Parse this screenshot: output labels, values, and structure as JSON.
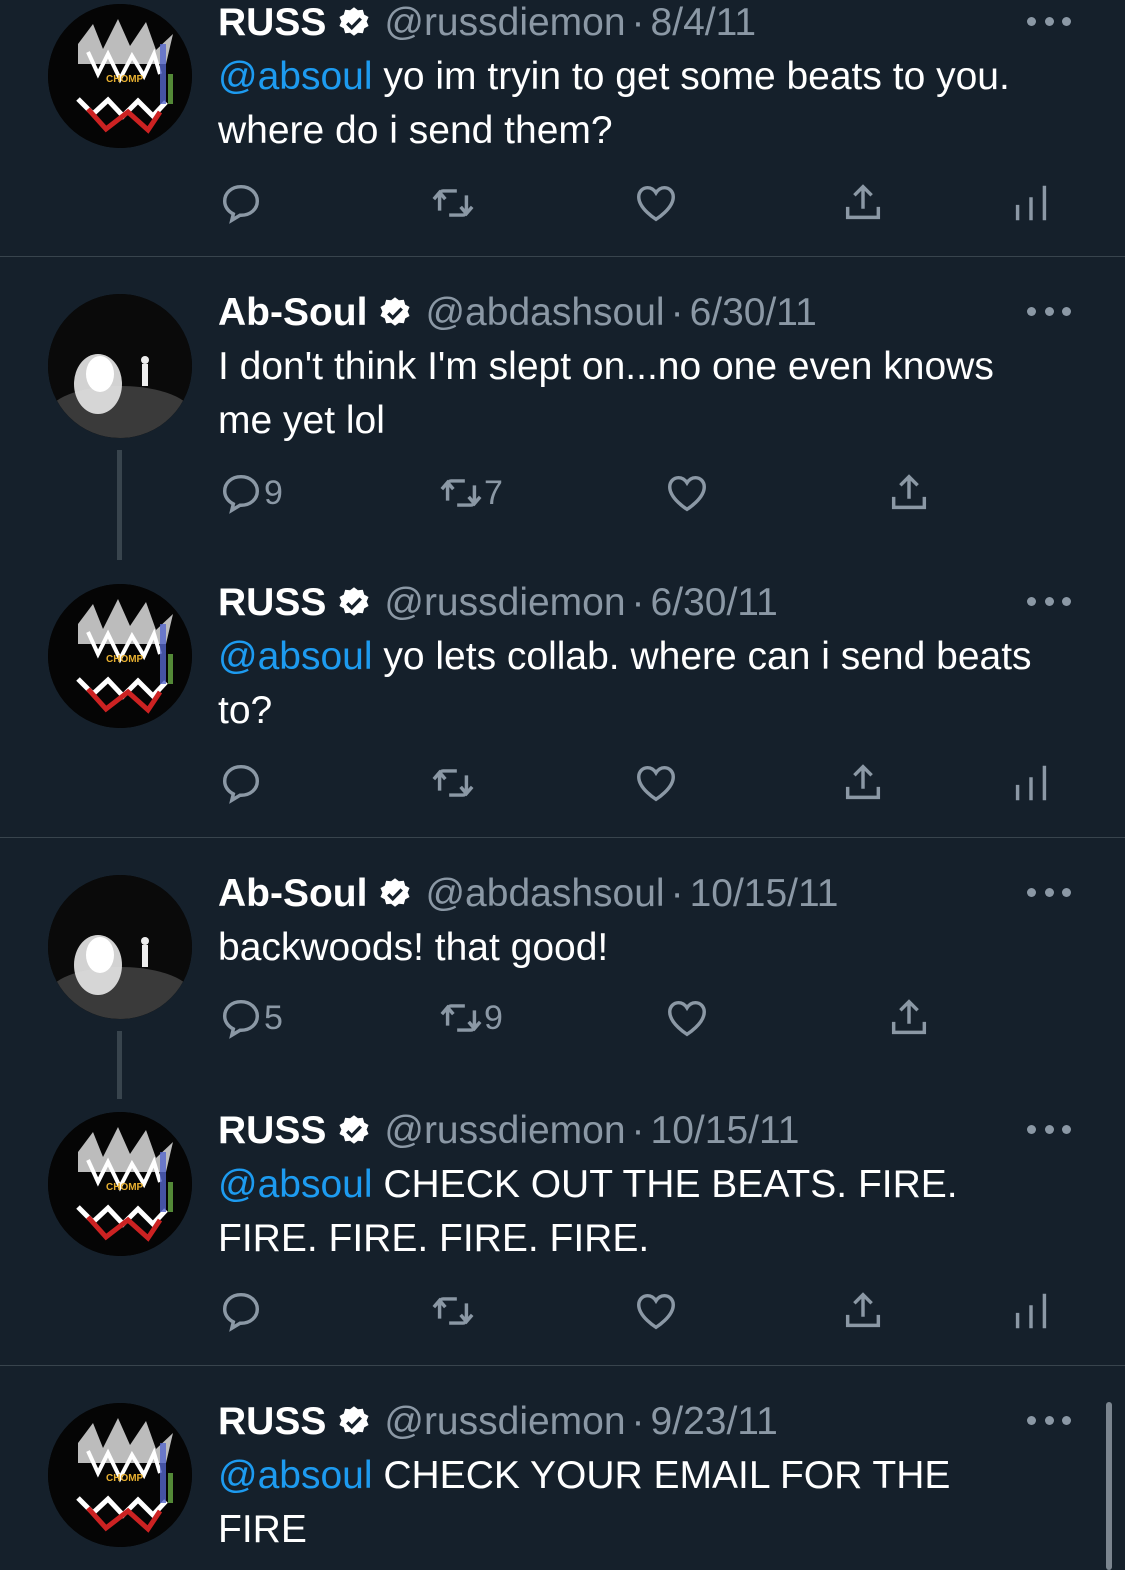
{
  "tweets": [
    {
      "name": "RUSS",
      "handle": "@russdiemon",
      "sep": "·",
      "date": "8/4/11",
      "mention": "@absoul",
      "text": " yo im tryin to get some beats to you. where do i send them?",
      "reply_count": "",
      "retweet_count": ""
    },
    {
      "name": "Ab-Soul",
      "handle": "@abdashsoul",
      "sep": "·",
      "date": "6/30/11",
      "mention": "",
      "text": "I don't think I'm slept on...no one even knows me yet lol",
      "reply_count": "9",
      "retweet_count": "7"
    },
    {
      "name": "RUSS",
      "handle": "@russdiemon",
      "sep": "·",
      "date": "6/30/11",
      "mention": "@absoul",
      "text": " yo lets collab. where can i send beats to?",
      "reply_count": "",
      "retweet_count": ""
    },
    {
      "name": "Ab-Soul",
      "handle": "@abdashsoul",
      "sep": "·",
      "date": "10/15/11",
      "mention": "",
      "text": "backwoods!  that good!",
      "reply_count": "5",
      "retweet_count": "9"
    },
    {
      "name": "RUSS",
      "handle": "@russdiemon",
      "sep": "·",
      "date": "10/15/11",
      "mention": "@absoul",
      "text": " CHECK OUT THE BEATS. FIRE. FIRE. FIRE. FIRE. FIRE.",
      "reply_count": "",
      "retweet_count": ""
    },
    {
      "name": "RUSS",
      "handle": "@russdiemon",
      "sep": "·",
      "date": "9/23/11",
      "mention": "@absoul",
      "text": " CHECK YOUR EMAIL FOR THE FIRE",
      "reply_count": "",
      "retweet_count": ""
    }
  ],
  "avatar_russ_text": "CHOMP",
  "icons": {
    "reply": "reply-icon",
    "retweet": "retweet-icon",
    "like": "heart-icon",
    "share": "share-icon",
    "analytics": "analytics-icon",
    "more": "more-icon",
    "verified": "verified-badge-icon"
  },
  "colors": {
    "background": "#15202b",
    "divider": "#38444d",
    "secondary_text": "#8b98a5",
    "mention": "#1d9bf0"
  }
}
